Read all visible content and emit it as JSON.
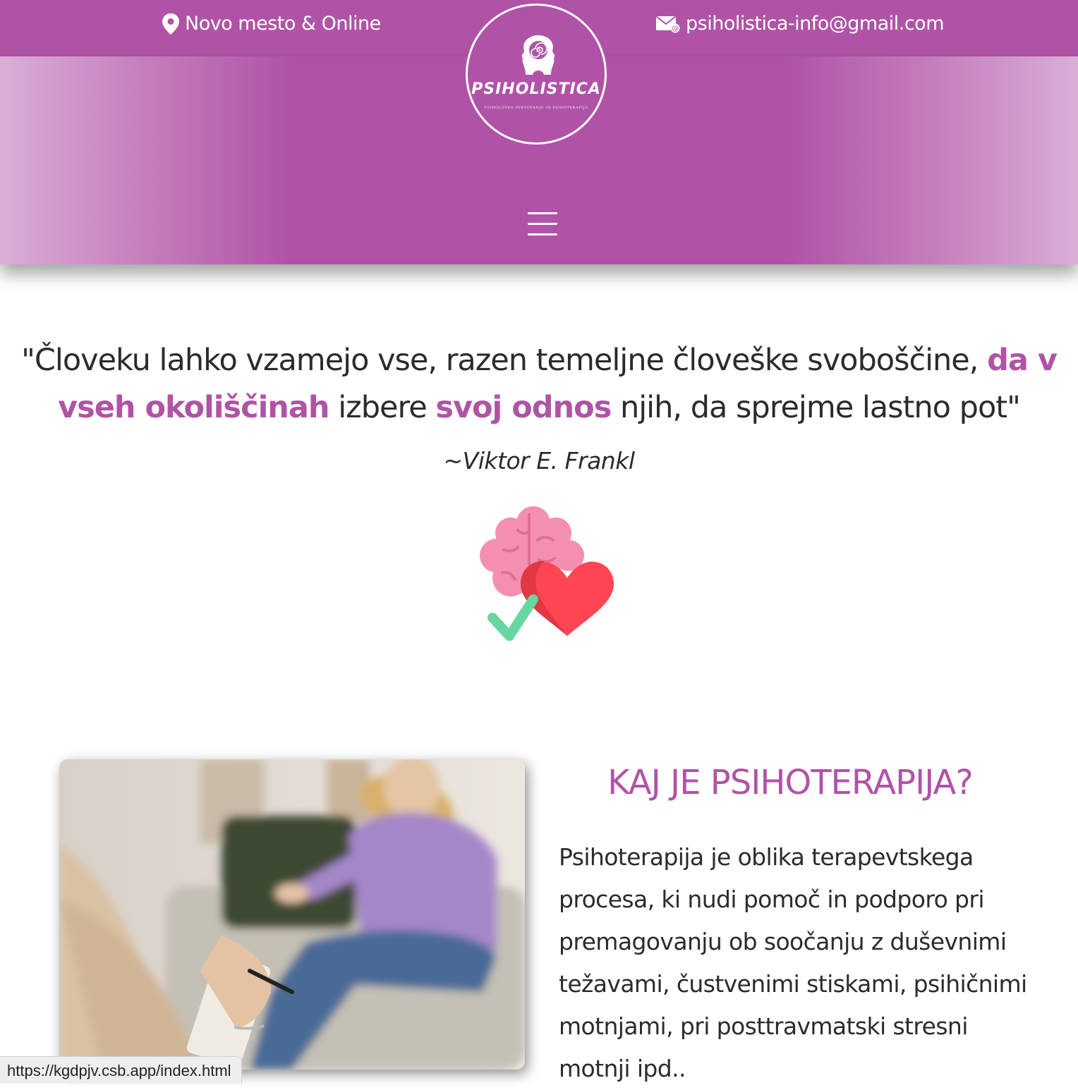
{
  "header": {
    "location": "Novo mesto & Online",
    "email": "psiholistica-info@gmail.com",
    "logo": {
      "title": "PSIHOLISTICA",
      "subtitle": "PSIHOLOŠKO SVETOVANJE IN PSIHOTERAPIJA"
    },
    "menu_icon": "hamburger-menu-icon"
  },
  "quote": {
    "part1": "\"Človeku lahko vzamejo vse, razen temeljne človeške svoboščine, ",
    "highlight1": "da v vseh okoliščinah",
    "part2": " izbere ",
    "highlight2": "svoj odnos",
    "part3": " njih, da sprejme lastno pot\"",
    "author": "~Viktor E. Frankl"
  },
  "illustration_icon": "brain-heart-check-icon",
  "section": {
    "title": "KAJ JE PSIHOTERAPIJA?",
    "text": "Psihoterapija je oblika terapevtskega procesa, ki nudi pomoč in podporo pri premagovanju ob soočanju z duševnimi težavami, čustvenimi stiskami, psihičnimi motnjami, pri posttravmatski stresni motnji ipd..",
    "image": "therapy-session-photo"
  },
  "status_url": "https://kgdpjv.csb.app/index.html",
  "colors": {
    "brand": "#b053a6",
    "band_edge": "#dbaed7",
    "text": "#2b2b2b"
  }
}
